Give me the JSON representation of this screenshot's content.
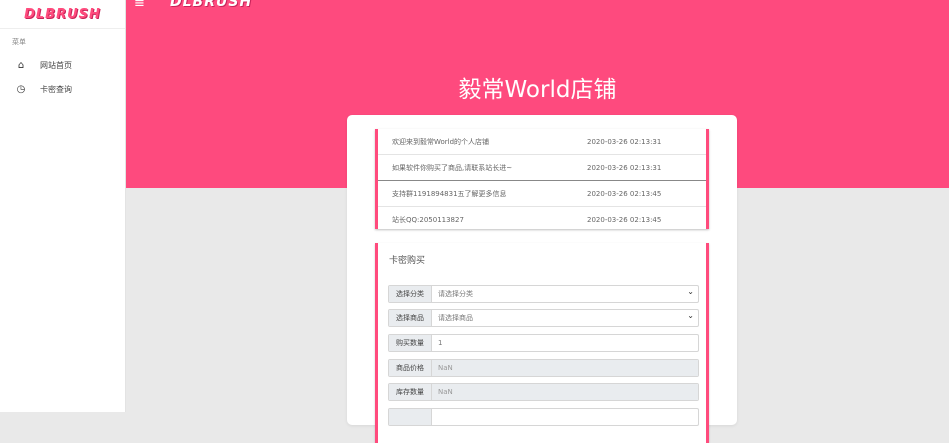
{
  "sidebar": {
    "logo": "DLBRUSH",
    "section_title": "菜单",
    "items": [
      {
        "label": "网站首页",
        "icon": "home-icon"
      },
      {
        "label": "卡密查询",
        "icon": "globe-icon"
      }
    ]
  },
  "header": {
    "menu_icon": "hamburger-icon",
    "logo": "DLBRUSH",
    "shop_title": "毅常World店铺",
    "color": "#fe4a7e"
  },
  "notices": [
    {
      "text": "欢迎来到毅常World的个人店铺",
      "date": "2020-03-26 02:13:31"
    },
    {
      "text": "如果软件你购买了商品,请联系站长进~",
      "date": "2020-03-26 02:13:31"
    },
    {
      "text": "支持群1191894831五了解更多信息",
      "date": "2020-03-26 02:13:45"
    },
    {
      "text": "站长QQ:2050113827",
      "date": "2020-03-26 02:13:45"
    }
  ],
  "order_form": {
    "title": "卡密购买",
    "fields": [
      {
        "label": "选择分类",
        "value": "请选择分类",
        "type": "select"
      },
      {
        "label": "选择商品",
        "value": "请选择商品",
        "type": "select"
      },
      {
        "label": "购买数量",
        "value": "1",
        "type": "input"
      },
      {
        "label": "商品价格",
        "value": "NaN",
        "type": "readonly"
      },
      {
        "label": "库存数量",
        "value": "NaN",
        "type": "readonly"
      }
    ]
  },
  "colors": {
    "accent": "#fe4a7e",
    "background": "#e9e9e9"
  }
}
